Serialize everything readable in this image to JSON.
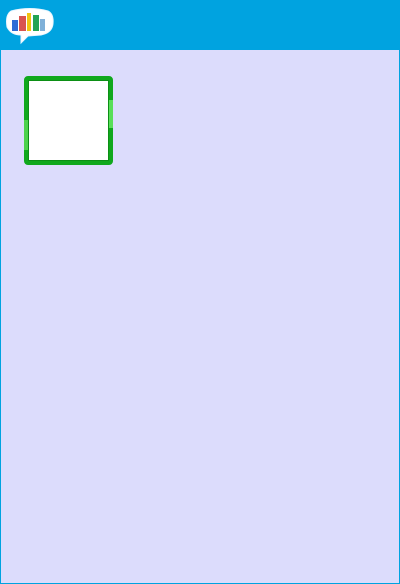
{
  "app": {
    "logo_text": "talk"
  },
  "colors": {
    "header": "#00a3e0",
    "background": "#dcdcfc",
    "tile_border": "#10a81d",
    "tile_fill": "#ffffff"
  },
  "main": {
    "tile": {
      "selected": true
    }
  }
}
